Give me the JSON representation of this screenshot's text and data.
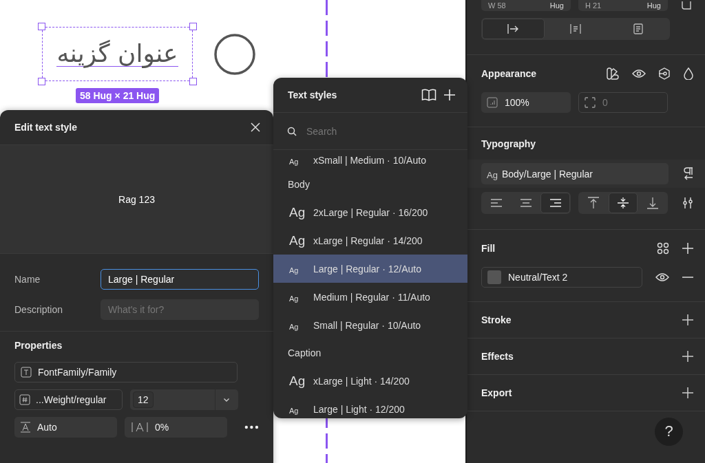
{
  "canvas": {
    "text_layer": "عنوان گزینه",
    "size_badge": "58 Hug × 21 Hug"
  },
  "edit_text_style": {
    "title": "Edit text style",
    "preview": "Rag 123",
    "name_label": "Name",
    "name_value": "Large | Regular",
    "description_label": "Description",
    "description_placeholder": "What's it for?",
    "properties_title": "Properties",
    "font_family": "FontFamily/Family",
    "font_weight": "...Weight/regular",
    "font_size": "12",
    "line_height": "Auto",
    "letter_spacing": "0%"
  },
  "text_styles": {
    "title": "Text styles",
    "search_placeholder": "Search",
    "items": [
      {
        "kind": "small",
        "sample": "Ag",
        "label": "xSmall | Medium · 10/Auto",
        "selected": false
      },
      {
        "kind": "group",
        "label": "Body"
      },
      {
        "kind": "big",
        "sample": "Ag",
        "label": "2xLarge | Regular · 16/200",
        "selected": false
      },
      {
        "kind": "big",
        "sample": "Ag",
        "label": "xLarge | Regular · 14/200",
        "selected": false
      },
      {
        "kind": "small",
        "sample": "Ag",
        "label": "Large | Regular · 12/Auto",
        "selected": true
      },
      {
        "kind": "small",
        "sample": "Ag",
        "label": "Medium | Regular · 11/Auto",
        "selected": false
      },
      {
        "kind": "small",
        "sample": "Ag",
        "label": "Small | Regular · 10/Auto",
        "selected": false
      },
      {
        "kind": "group",
        "label": "Caption"
      },
      {
        "kind": "big",
        "sample": "Ag",
        "label": "xLarge | Light · 14/200",
        "selected": false
      },
      {
        "kind": "small",
        "sample": "Ag",
        "label": "Large | Light · 12/200",
        "selected": false
      }
    ]
  },
  "inspector": {
    "size_fields": [
      {
        "axis": "W",
        "value": "58",
        "mode": "Hug"
      },
      {
        "axis": "H",
        "value": "21",
        "mode": "Hug"
      }
    ],
    "resize_modes": [
      {
        "kind": "width",
        "selected": true
      },
      {
        "kind": "fixed",
        "selected": false
      },
      {
        "kind": "block",
        "selected": false
      }
    ],
    "appearance": {
      "title": "Appearance",
      "opacity": "100%",
      "radius": "0"
    },
    "typography": {
      "title": "Typography",
      "sample": "Ag",
      "style": "Body/Large | Regular",
      "h_align": [
        {
          "kind": "left",
          "selected": false
        },
        {
          "kind": "center",
          "selected": false
        },
        {
          "kind": "right",
          "selected": true
        }
      ],
      "v_align": [
        {
          "kind": "top",
          "selected": false
        },
        {
          "kind": "middle",
          "selected": true
        },
        {
          "kind": "bottom",
          "selected": false
        }
      ]
    },
    "fill": {
      "title": "Fill",
      "value": "Neutral/Text 2"
    },
    "sections": [
      "Stroke",
      "Effects",
      "Export"
    ],
    "help": "?"
  }
}
